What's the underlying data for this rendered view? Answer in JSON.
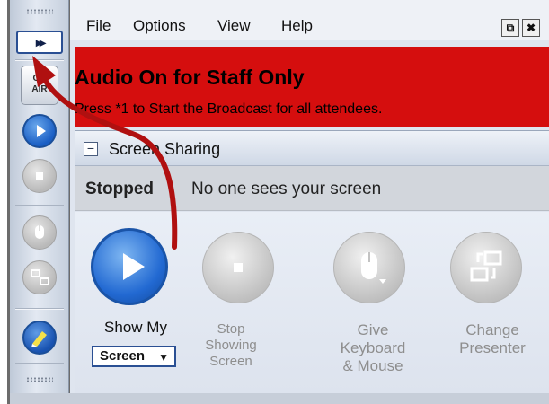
{
  "menubar": {
    "items": [
      "File",
      "Options",
      "View",
      "Help"
    ],
    "restore_glyph": "⧉",
    "close_glyph": "✖"
  },
  "toolbar": {
    "expand_label": "▸▸",
    "on_air_label": "ON\nAIR",
    "icons": [
      "play-icon",
      "stop-icon",
      "mouse-icon",
      "presenter-swap-icon",
      "highlighter-icon"
    ]
  },
  "banner": {
    "title": "Audio On for Staff Only",
    "subtitle": "Press *1 to Start the Broadcast for all attendees."
  },
  "section": {
    "collapse_glyph": "−",
    "title": "Screen Sharing"
  },
  "status": {
    "state": "Stopped",
    "description": "No one sees your screen"
  },
  "actions": {
    "show": {
      "label": "Show My",
      "select_value": "Screen",
      "icon": "play-icon"
    },
    "stop": {
      "line1": "Stop",
      "line2": "Showing",
      "line3": "Screen",
      "icon": "stop-icon"
    },
    "give": {
      "line1": "Give",
      "line2": "Keyboard",
      "line3": "& Mouse",
      "icon": "mouse-icon"
    },
    "change": {
      "line1": "Change",
      "line2": "Presenter",
      "icon": "presenter-swap-icon"
    }
  },
  "colors": {
    "banner_red": "#d50e0e",
    "accent_blue": "#2269d2",
    "annotation_arrow": "#b01010"
  }
}
